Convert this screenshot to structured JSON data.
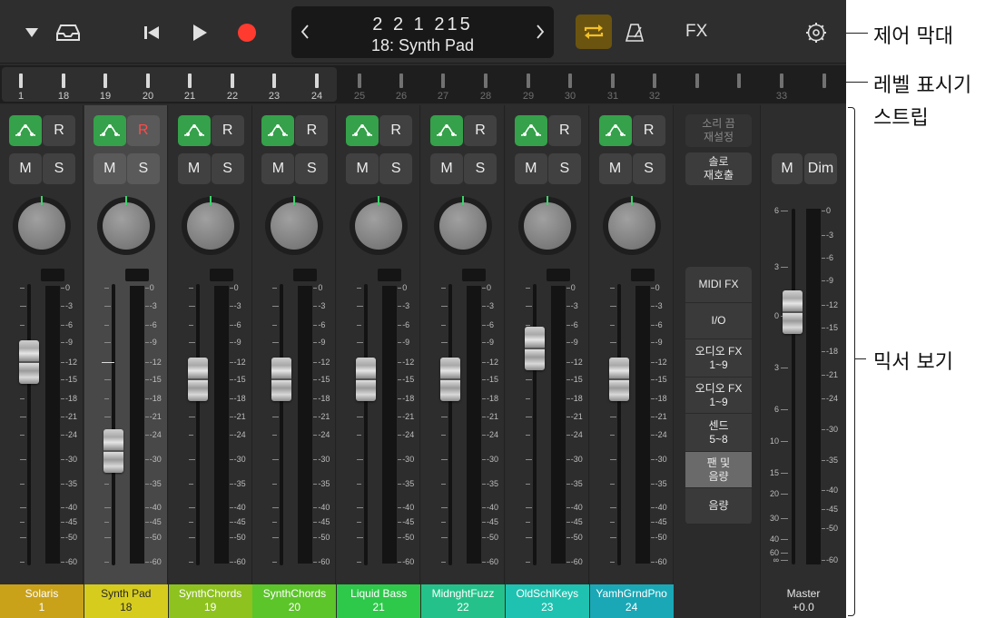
{
  "control_bar": {
    "menu_icon": "triangle-down-icon",
    "browser_icon": "tray-icon",
    "rewind_icon": "skip-back-icon",
    "play_icon": "play-icon",
    "record_icon": "record-icon",
    "position": "2 2 1 215",
    "patch_name": "18: Synth Pad",
    "prev_icon": "chevron-left-icon",
    "next_icon": "chevron-right-icon",
    "cycle_icon": "cycle-icon",
    "metronome_icon": "metronome-icon",
    "fx_label": "FX",
    "settings_icon": "gear-icon"
  },
  "level_meters": {
    "labels": [
      "1",
      "18",
      "19",
      "20",
      "21",
      "22",
      "23",
      "24",
      "25",
      "26",
      "27",
      "28",
      "29",
      "30",
      "31",
      "32",
      "",
      "",
      "33",
      ""
    ]
  },
  "strips": [
    {
      "name": "Solaris",
      "number": "1",
      "color": "#c9a21a",
      "fader_db": -12,
      "selected": false
    },
    {
      "name": "Synth Pad",
      "number": "18",
      "color": "#d6cc1e",
      "fader_db": -28,
      "selected": true
    },
    {
      "name": "SynthChords",
      "number": "19",
      "color": "#8dc21f",
      "fader_db": -15,
      "selected": false
    },
    {
      "name": "SynthChords",
      "number": "20",
      "color": "#5cc52a",
      "fader_db": -15,
      "selected": false
    },
    {
      "name": "Liquid Bass",
      "number": "21",
      "color": "#2ec84b",
      "fader_db": -15,
      "selected": false
    },
    {
      "name": "MidnghtFuzz",
      "number": "22",
      "color": "#24c28a",
      "fader_db": -15,
      "selected": false
    },
    {
      "name": "OldSchlKeys",
      "number": "23",
      "color": "#1fc2b0",
      "fader_db": -10,
      "selected": false
    },
    {
      "name": "YamhGrndPno",
      "number": "24",
      "color": "#1aa8b6",
      "fader_db": -15,
      "selected": false
    }
  ],
  "strip_buttons": {
    "automation_icon": "automation-curve-icon",
    "read_label": "R",
    "mute_label": "M",
    "solo_label": "S"
  },
  "meter_scale": [
    "0",
    "3",
    "6",
    "9",
    "12",
    "15",
    "18",
    "21",
    "24",
    "30",
    "35",
    "40",
    "45",
    "50",
    "60"
  ],
  "section": {
    "reset_mute": "소리 끔\n재설정",
    "solo_recall": "솔로\n재호출",
    "items": [
      "MIDI FX",
      "I/O",
      "오디오 FX\n1~9",
      "오디오 FX\n1~9",
      "센드\n5~8",
      "팬 및\n음량",
      "음량"
    ],
    "active_item": 5
  },
  "master": {
    "mute_label": "M",
    "dim_label": "Dim",
    "name": "Master",
    "value": "+0.0",
    "left_scale": [
      "6",
      "3",
      "0",
      "3",
      "6",
      "10",
      "15",
      "20",
      "30",
      "40",
      "60",
      "∞"
    ],
    "right_scale": [
      "0",
      "3",
      "6",
      "9",
      "12",
      "15",
      "18",
      "21",
      "24",
      "30",
      "35",
      "40",
      "45",
      "50",
      "60"
    ]
  },
  "callouts": {
    "control_bar": "제어 막대",
    "level_meters": "레벨 표시기",
    "strips": "스트립",
    "mixer_view": "믹서 보기"
  }
}
